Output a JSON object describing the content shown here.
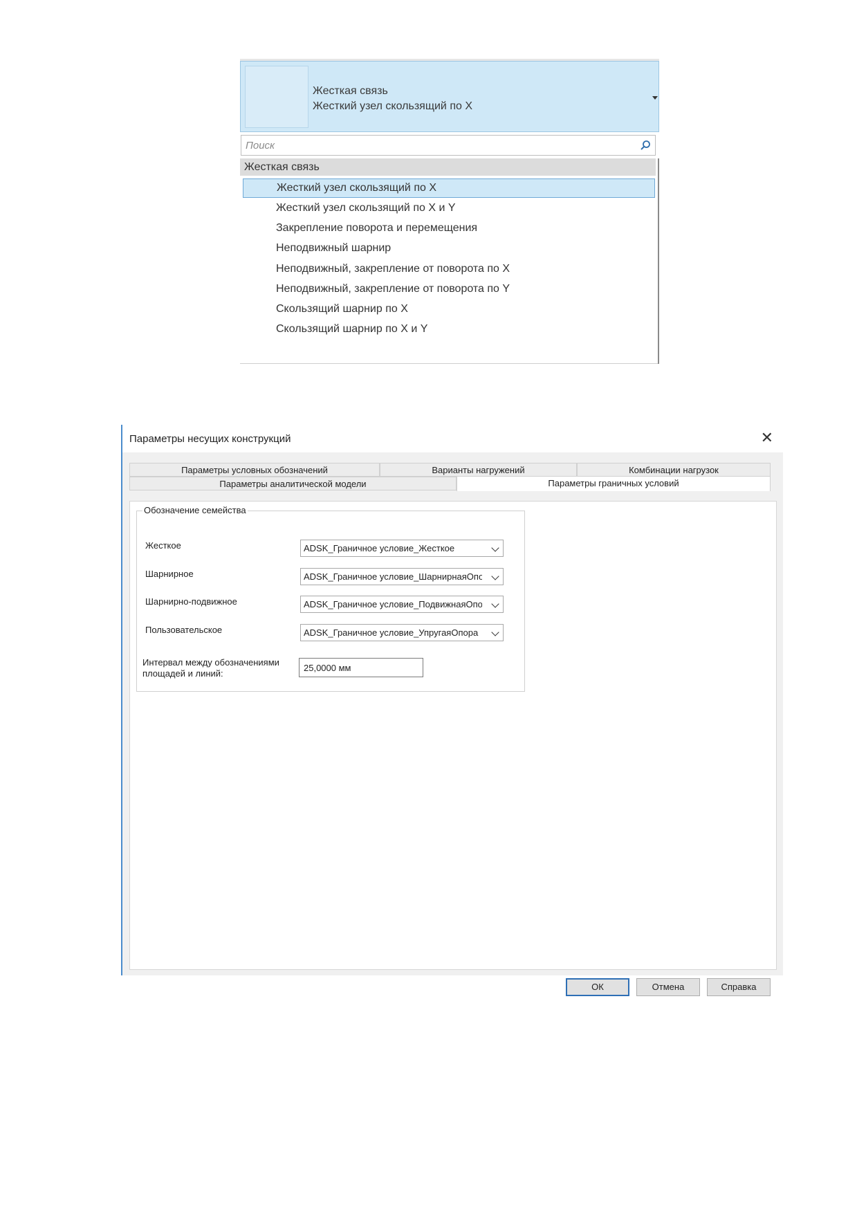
{
  "type_selector": {
    "family": "Жесткая связь",
    "type": "Жесткий узел скользящий по X",
    "search_placeholder": "Поиск",
    "group_header": "Жесткая связь",
    "items": [
      "Жесткий узел скользящий по X",
      "Жесткий узел скользящий по X и Y",
      "Закрепление поворота и перемещения",
      "Неподвижный шарнир",
      "Неподвижный, закрепление от поворота по X",
      "Неподвижный, закрепление от поворота по Y",
      "Скользящий шарнир по X",
      "Скользящий шарнир по X и Y"
    ],
    "selected_index": 0
  },
  "dialog": {
    "title": "Параметры несущих конструкций",
    "close_glyph": "✕",
    "tabs_row1": [
      "Параметры условных обозначений",
      "Варианты нагружений",
      "Комбинации нагрузок"
    ],
    "tabs_row2": [
      "Параметры аналитической модели",
      "Параметры граничных условий"
    ],
    "active_tab": "Параметры граничных условий",
    "group_title": "Обозначение семейства",
    "rows": [
      {
        "label": "Жесткое",
        "value": "ADSK_Граничное условие_Жесткое"
      },
      {
        "label": "Шарнирное",
        "value": "ADSK_Граничное условие_ШарнирнаяОпора"
      },
      {
        "label": "Шарнирно-подвижное",
        "value": "ADSK_Граничное условие_ПодвижнаяОпора"
      },
      {
        "label": "Пользовательское",
        "value": "ADSK_Граничное условие_УпругаяОпора"
      }
    ],
    "interval_label": "Интервал между обозначениями площадей и линий:",
    "interval_value": "25,0000 мм",
    "buttons": {
      "ok": "ОК",
      "cancel": "Отмена",
      "help": "Справка"
    }
  }
}
